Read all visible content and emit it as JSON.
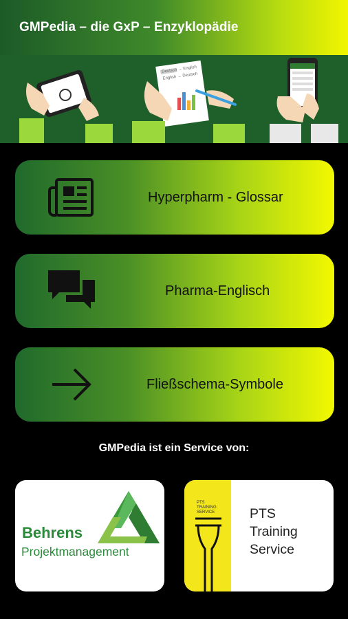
{
  "app_bar": {
    "title": "GMPedia – die GxP – Enzyklopädie"
  },
  "menu": [
    {
      "label": "Hyperpharm - Glossar",
      "icon": "newspaper-icon"
    },
    {
      "label": "Pharma-Englisch",
      "icon": "chat-bubbles-icon"
    },
    {
      "label": "Fließschema-Symbole",
      "icon": "arrow-right-icon"
    }
  ],
  "hero": {
    "sheet_line_1": "Deutsch → English",
    "sheet_line_2": "English → Deutsch"
  },
  "service_line": "GMPedia ist ein Service von:",
  "partners": {
    "behrens": {
      "name": "Behrens",
      "subtitle": "Projektmanagement"
    },
    "pts": {
      "mini_1": "PTS",
      "mini_2": "TRAINING",
      "mini_3": "SERVICE",
      "line_1": "PTS",
      "line_2": "Training",
      "line_3": "Service"
    }
  },
  "colors": {
    "brand_green": "#1f5f2a",
    "accent_yellow": "#f3f800",
    "behrens_green": "#2a8a3a",
    "pts_yellow": "#f3e61a"
  }
}
